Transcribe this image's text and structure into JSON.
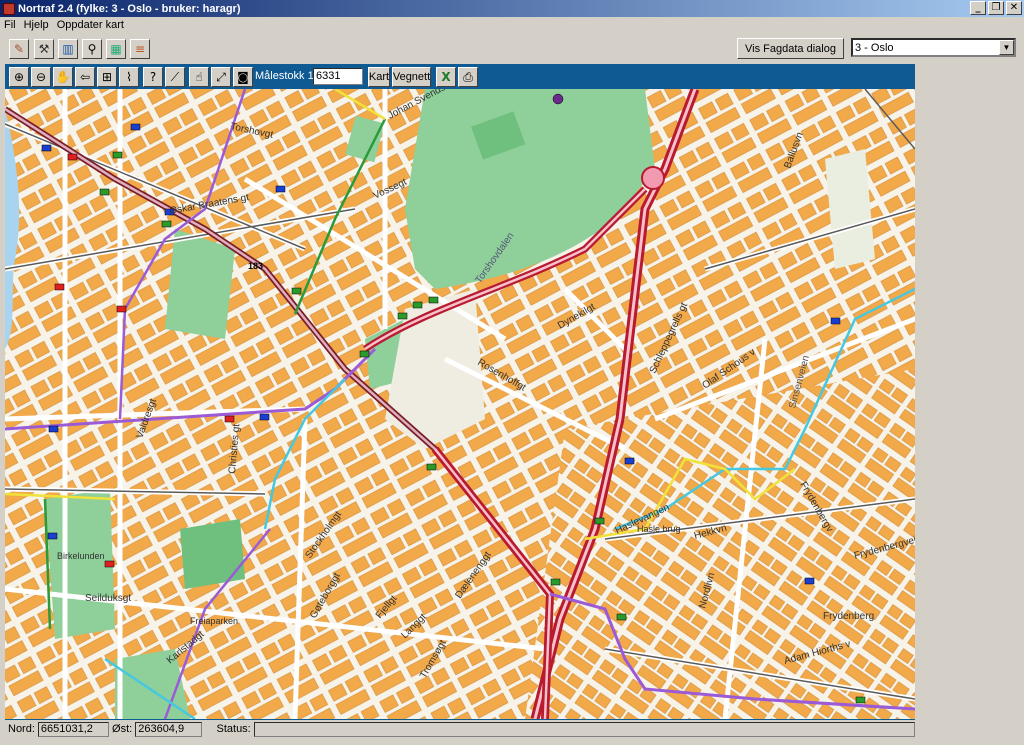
{
  "window": {
    "title": "Nortraf 2.4 (fylke: 3 - Oslo - bruker: haragr)"
  },
  "menu": [
    "Fil",
    "Hjelp",
    "Oppdater kart"
  ],
  "topbar": {
    "fagdata_button": "Vis Fagdata dialog",
    "fylke_selected": "3 - Oslo"
  },
  "maptoolbar": {
    "scale_label": "Målestokk  1:",
    "scale_value": "6331",
    "kart_button": "Kart",
    "vegnett_button": "Vegnett"
  },
  "map": {
    "street_labels": [
      "Torshovgt",
      "Johan Svendsens gt",
      "Vossegt",
      "Oskar Braatens gt",
      "Torshovdalen",
      "Dynekilgt",
      "Rosenhoffgt",
      "Schleppegrells gt",
      "Olaf Schous v",
      "Sinsenveien",
      "Valdresgt",
      "Christies gt",
      "Stockholmgt",
      "Birkelunden",
      "Seilduksgt",
      "Freiaparken",
      "Karlstadgt",
      "Gøteborggt",
      "Fjellgt",
      "Langgt",
      "Dælenenggt",
      "Tromsøgt",
      "Haslevangen",
      "Hasle brug",
      "Hekkvn",
      "Nordlivn",
      "Frydenberg",
      "Adam Hiorths v",
      "Frydenbergv",
      "Ballusvn",
      "Frydenbergveien",
      "183"
    ]
  },
  "status": {
    "nord_label": "Nord:",
    "nord_value": "6651031,2",
    "ost_label": "Øst:",
    "ost_value": "263604,9",
    "status_label": "Status:",
    "status_value": ""
  },
  "colors": {
    "title_start": "#0a246a",
    "title_end": "#a6caf0",
    "map_frame": "#0b5c93",
    "block": "#f2a94a",
    "main_road": "#c0182a",
    "park": "#8fcf9a"
  }
}
